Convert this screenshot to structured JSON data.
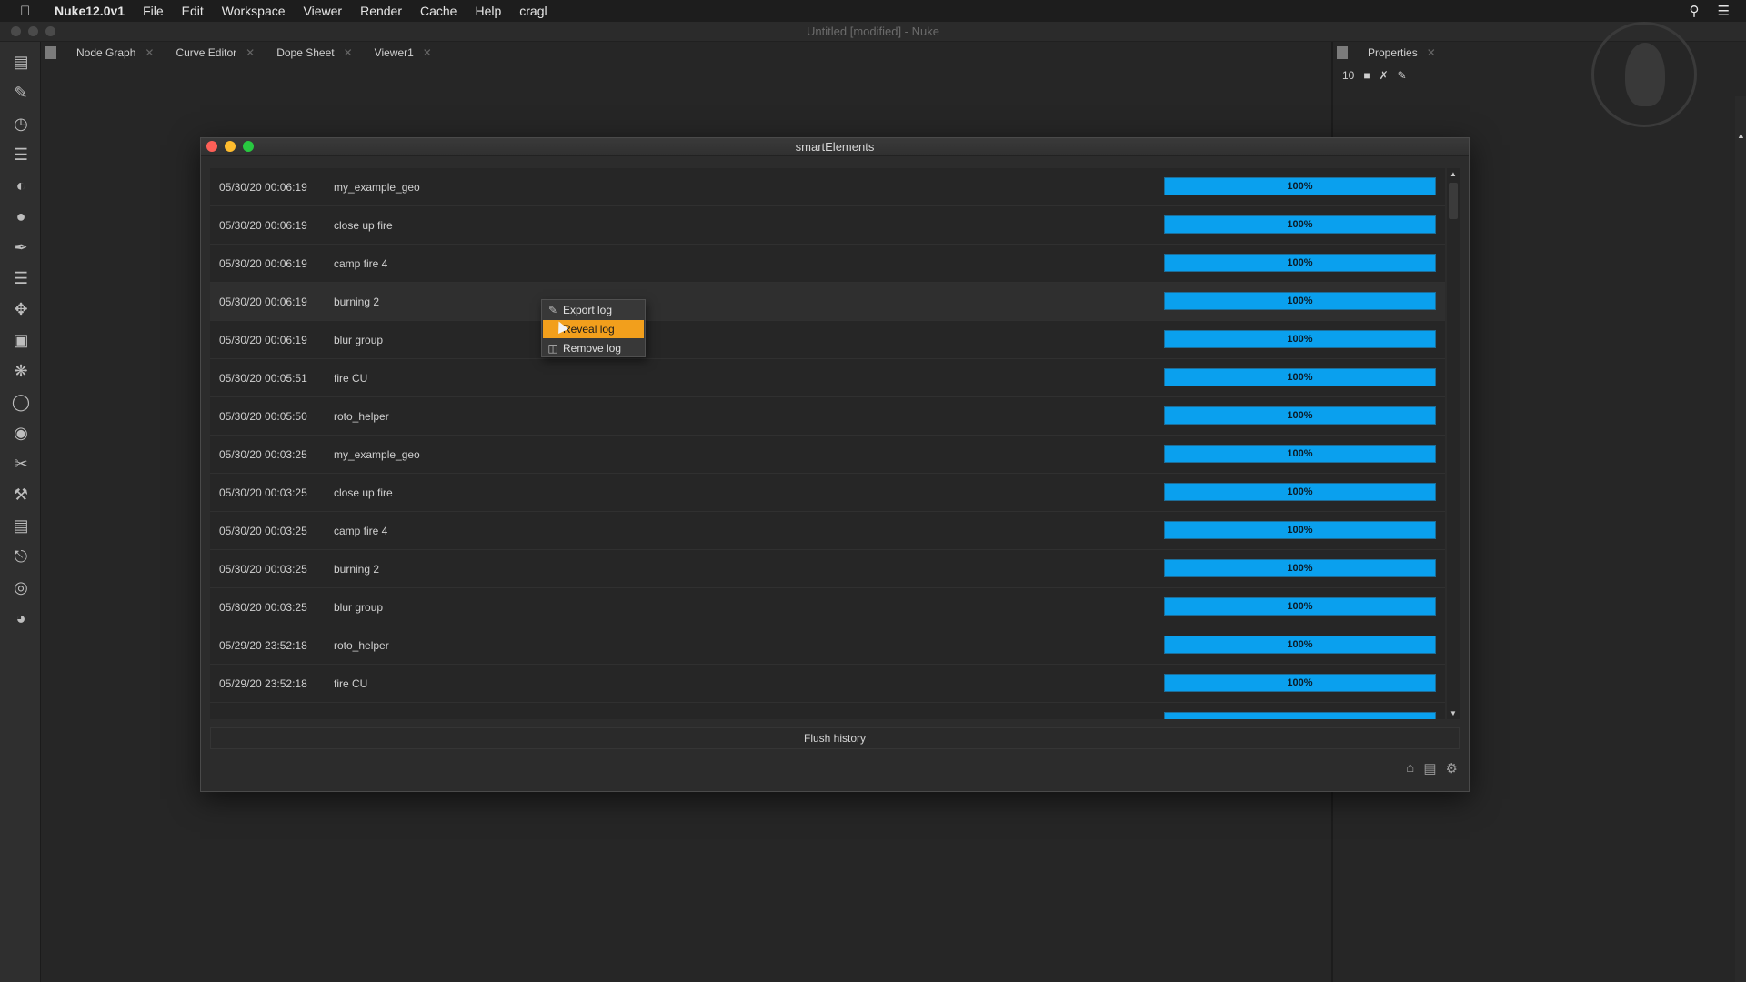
{
  "menubar": {
    "app_name": "Nuke12.0v1",
    "items": [
      "File",
      "Edit",
      "Workspace",
      "Viewer",
      "Render",
      "Cache",
      "Help",
      "cragl"
    ]
  },
  "window": {
    "title": "Untitled [modified] - Nuke"
  },
  "left_tabs": [
    {
      "label": "Node Graph"
    },
    {
      "label": "Curve Editor"
    },
    {
      "label": "Dope Sheet"
    },
    {
      "label": "Viewer1"
    }
  ],
  "properties": {
    "tab_label": "Properties",
    "max_panels": "10"
  },
  "dialog": {
    "title": "smartElements",
    "flush_label": "Flush history",
    "rows": [
      {
        "date": "05/30/20 00:06:19",
        "name": "my_example_geo",
        "progress": "100%"
      },
      {
        "date": "05/30/20 00:06:19",
        "name": "close up fire",
        "progress": "100%"
      },
      {
        "date": "05/30/20 00:06:19",
        "name": "camp fire 4",
        "progress": "100%"
      },
      {
        "date": "05/30/20 00:06:19",
        "name": "burning 2",
        "progress": "100%"
      },
      {
        "date": "05/30/20 00:06:19",
        "name": "blur group",
        "progress": "100%"
      },
      {
        "date": "05/30/20 00:05:51",
        "name": "fire CU",
        "progress": "100%"
      },
      {
        "date": "05/30/20 00:05:50",
        "name": "roto_helper",
        "progress": "100%"
      },
      {
        "date": "05/30/20 00:03:25",
        "name": "my_example_geo",
        "progress": "100%"
      },
      {
        "date": "05/30/20 00:03:25",
        "name": "close up fire",
        "progress": "100%"
      },
      {
        "date": "05/30/20 00:03:25",
        "name": "camp fire 4",
        "progress": "100%"
      },
      {
        "date": "05/30/20 00:03:25",
        "name": "burning 2",
        "progress": "100%"
      },
      {
        "date": "05/30/20 00:03:25",
        "name": "blur group",
        "progress": "100%"
      },
      {
        "date": "05/29/20 23:52:18",
        "name": "roto_helper",
        "progress": "100%"
      },
      {
        "date": "05/29/20 23:52:18",
        "name": "fire CU",
        "progress": "100%"
      }
    ]
  },
  "context_menu": {
    "items": [
      {
        "label": "Export log",
        "icon": "export-icon"
      },
      {
        "label": "Reveal log",
        "icon": "reveal-icon"
      },
      {
        "label": "Remove log",
        "icon": "trash-icon"
      }
    ],
    "active_index": 1
  },
  "colors": {
    "progress": "#0aa0ee",
    "menu_highlight": "#f29f1c"
  }
}
